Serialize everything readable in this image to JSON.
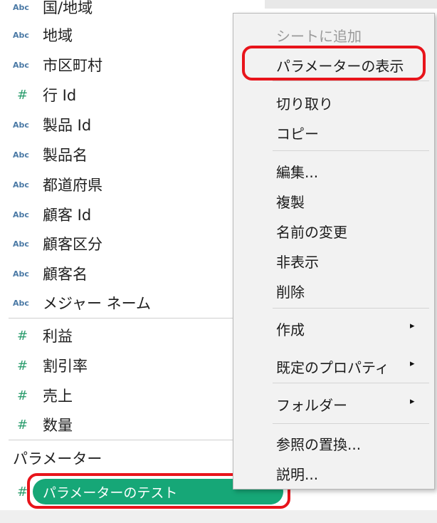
{
  "fields": [
    {
      "type": "Abc",
      "label": "国/地域"
    },
    {
      "type": "Abc",
      "label": "地域"
    },
    {
      "type": "Abc",
      "label": "市区町村"
    },
    {
      "type": "#",
      "label": "行 Id"
    },
    {
      "type": "Abc",
      "label": "製品 Id"
    },
    {
      "type": "Abc",
      "label": "製品名"
    },
    {
      "type": "Abc",
      "label": "都道府県"
    },
    {
      "type": "Abc",
      "label": "顧客 Id"
    },
    {
      "type": "Abc",
      "label": "顧客区分"
    },
    {
      "type": "Abc",
      "label": "顧客名"
    },
    {
      "type": "Abc",
      "label": "メジャー ネーム"
    }
  ],
  "measures": [
    {
      "type": "#",
      "label": "利益"
    },
    {
      "type": "#",
      "label": "割引率"
    },
    {
      "type": "#",
      "label": "売上"
    },
    {
      "type": "#",
      "label": "数量"
    }
  ],
  "parameters": {
    "title": "パラメーター",
    "icon": "#",
    "item": "パラメーターのテスト"
  },
  "menu": {
    "add_to_sheet": "シートに追加",
    "show_parameter": "パラメーターの表示",
    "cut": "切り取り",
    "copy": "コピー",
    "edit": "編集...",
    "duplicate": "複製",
    "rename": "名前の変更",
    "hide": "非表示",
    "delete": "削除",
    "create": "作成",
    "default_properties": "既定のプロパティ",
    "folder": "フォルダー",
    "replace_references": "参照の置換...",
    "describe": "説明...",
    "submenu_arrow": "▸"
  },
  "colors": {
    "highlight_red": "#e8141b",
    "parameter_green": "#16a777",
    "dimension_icon": "#4a79a5",
    "measure_icon": "#2e9e6f"
  }
}
